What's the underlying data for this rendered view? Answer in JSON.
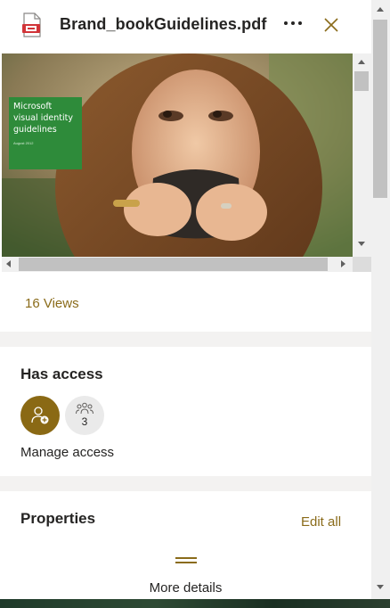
{
  "header": {
    "file_name": "Brand_bookGuidelines.pdf",
    "file_icon": "pdf-file-icon",
    "more_icon": "more-options-icon",
    "close_icon": "close-icon"
  },
  "preview": {
    "cover_title": "Microsoft visual identity guidelines",
    "cover_date": "August 2012"
  },
  "views": {
    "label": "16 Views"
  },
  "access": {
    "title": "Has access",
    "owner_icon": "add-person-icon",
    "group_icon": "people-group-icon",
    "group_count": "3",
    "manage_label": "Manage access"
  },
  "properties": {
    "title": "Properties",
    "edit_all_label": "Edit all",
    "handle_icon": "drag-handle-icon",
    "more_details_label": "More details"
  },
  "colors": {
    "accent": "#8a6b1a",
    "owner_avatar": "#8a6914",
    "cover_green": "#2e8b3a"
  }
}
